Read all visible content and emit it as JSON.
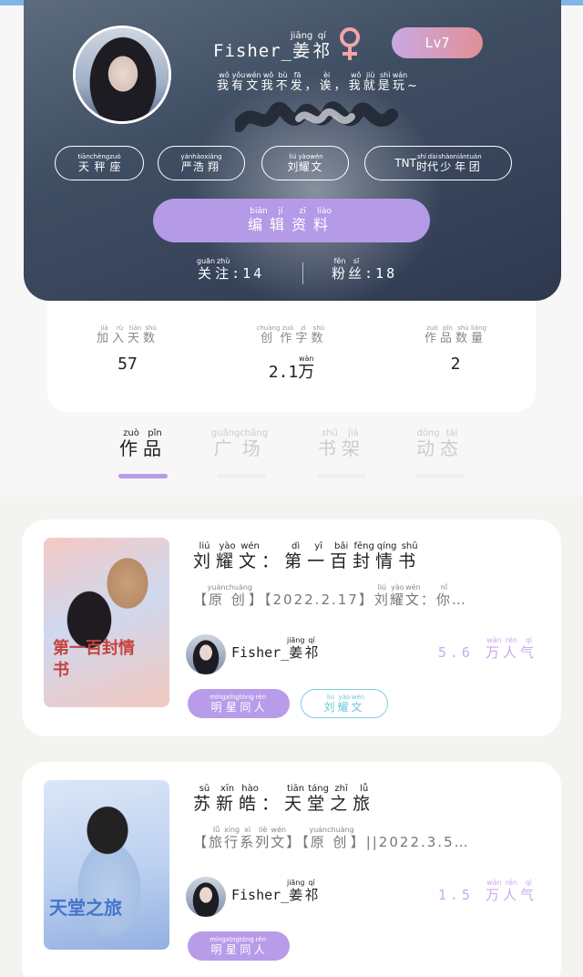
{
  "profile": {
    "name": {
      "latin": "Fisher_",
      "han": "姜祁",
      "pinyin": [
        "jiāng",
        "qí"
      ]
    },
    "gender_icon": "female-symbol-icon",
    "level": "Lv7",
    "bio": {
      "han": [
        "我",
        "有",
        "文",
        "我",
        "不",
        "发",
        "，",
        "诶",
        "，",
        "我",
        "就",
        "是",
        "玩",
        "~"
      ],
      "pinyin": [
        "wǒ",
        "yǒu",
        "wén",
        "wǒ",
        "bù",
        "fā",
        "",
        "èi",
        "",
        "wǒ",
        "jiù",
        "shì",
        "wán",
        ""
      ]
    },
    "tags": [
      {
        "han": "天秤座",
        "pinyin": [
          "tiān",
          "chèng",
          "zuò"
        ]
      },
      {
        "han": "严浩翔",
        "pinyin": [
          "yán",
          "hào",
          "xiáng"
        ]
      },
      {
        "han": "刘耀文",
        "pinyin": [
          "liú",
          "yào",
          "wén"
        ]
      },
      {
        "latin": "TNT",
        "han": "时代少年团",
        "pinyin": [
          "shí",
          "dài",
          "shào",
          "nián",
          "tuán"
        ]
      }
    ],
    "edit_button": {
      "han": "编辑资料",
      "pinyin": [
        "biān",
        "jí",
        "zī",
        "liào"
      ]
    },
    "following": {
      "han": "关注",
      "pinyin": [
        "guān",
        "zhù"
      ],
      "value": "14"
    },
    "fans": {
      "han": "粉丝",
      "pinyin": [
        "fěn",
        "sī"
      ],
      "value": "18"
    },
    "colors": {
      "card": "#3f4d62",
      "edit_button": "#b59ae7",
      "badge_start": "#c9a9e2",
      "badge_end": "#e18f96"
    }
  },
  "stats": [
    {
      "han": "加入天数",
      "pinyin": [
        "jiā",
        "rù",
        "tiān",
        "shù"
      ],
      "value": "57"
    },
    {
      "han": "创作字数",
      "pinyin": [
        "chuàng",
        "zuò",
        "zì",
        "shù"
      ],
      "value_num": "2.1",
      "value_unit": "万",
      "value_unit_pinyin": "wàn"
    },
    {
      "han": "作品数量",
      "pinyin": [
        "zuò",
        "pǐn",
        "shù",
        "liàng"
      ],
      "value": "2"
    }
  ],
  "tabs": [
    {
      "han": "作品",
      "pinyin": [
        "zuò",
        "pǐn"
      ],
      "active": true
    },
    {
      "han": "广场",
      "pinyin": [
        "guǎng",
        "chǎng"
      ],
      "active": false
    },
    {
      "han": "书架",
      "pinyin": [
        "shū",
        "jià"
      ],
      "active": false
    },
    {
      "han": "动态",
      "pinyin": [
        "dòng",
        "tài"
      ],
      "active": false
    }
  ],
  "works": [
    {
      "title": {
        "han": [
          "刘",
          "耀",
          "文",
          "：",
          "第",
          "一",
          "百",
          "封",
          "情",
          "书"
        ],
        "pinyin": [
          "liú",
          "yào",
          "wén",
          "",
          "dì",
          "yī",
          "bǎi",
          "fēng",
          "qíng",
          "shū"
        ]
      },
      "meta": {
        "han": [
          "【",
          "原",
          "创",
          "】",
          "【2022.2.17】",
          "刘",
          "耀",
          "文",
          "：",
          "你",
          "…"
        ],
        "pinyin": [
          "",
          "yuán",
          "chuàng",
          "",
          "",
          "liú",
          "yào",
          "wén",
          "",
          "nǐ",
          ""
        ]
      },
      "cover_text": "第一百封情书",
      "author": {
        "latin": "Fisher_",
        "han": "姜祁",
        "pinyin": [
          "jiāng",
          "qí"
        ]
      },
      "popularity": {
        "num": "5.6",
        "han": [
          "万",
          "人",
          "气"
        ],
        "pinyin": [
          "wàn",
          "rén",
          "qì"
        ]
      },
      "pills": [
        {
          "han": "明星同人",
          "pinyin": [
            "míng",
            "xīng",
            "tóng",
            "rén"
          ],
          "style": "purple"
        },
        {
          "han": "刘耀文",
          "pinyin": [
            "liú",
            "yào",
            "wén"
          ],
          "style": "outline"
        }
      ]
    },
    {
      "title": {
        "han": [
          "苏",
          "新",
          "皓",
          "：",
          "天",
          "堂",
          "之",
          "旅"
        ],
        "pinyin": [
          "sū",
          "xīn",
          "hào",
          "",
          "tiān",
          "táng",
          "zhī",
          "lǚ"
        ]
      },
      "meta": {
        "han": [
          "【",
          "旅",
          "行",
          "系",
          "列",
          "文",
          "】",
          "【",
          "原",
          "创",
          "】",
          "||2022.3.5…"
        ],
        "pinyin": [
          "",
          "lǚ",
          "xíng",
          "xì",
          "liè",
          "wén",
          "",
          "",
          "yuán",
          "chuàng",
          "",
          ""
        ]
      },
      "cover_text": "天堂之旅",
      "author": {
        "latin": "Fisher_",
        "han": "姜祁",
        "pinyin": [
          "jiāng",
          "qí"
        ]
      },
      "popularity": {
        "num": "1.5",
        "han": [
          "万",
          "人",
          "气"
        ],
        "pinyin": [
          "wàn",
          "rén",
          "qì"
        ]
      },
      "pills": [
        {
          "han": "明星同人",
          "pinyin": [
            "míng",
            "xīng",
            "tóng",
            "rén"
          ],
          "style": "purple"
        }
      ]
    }
  ]
}
